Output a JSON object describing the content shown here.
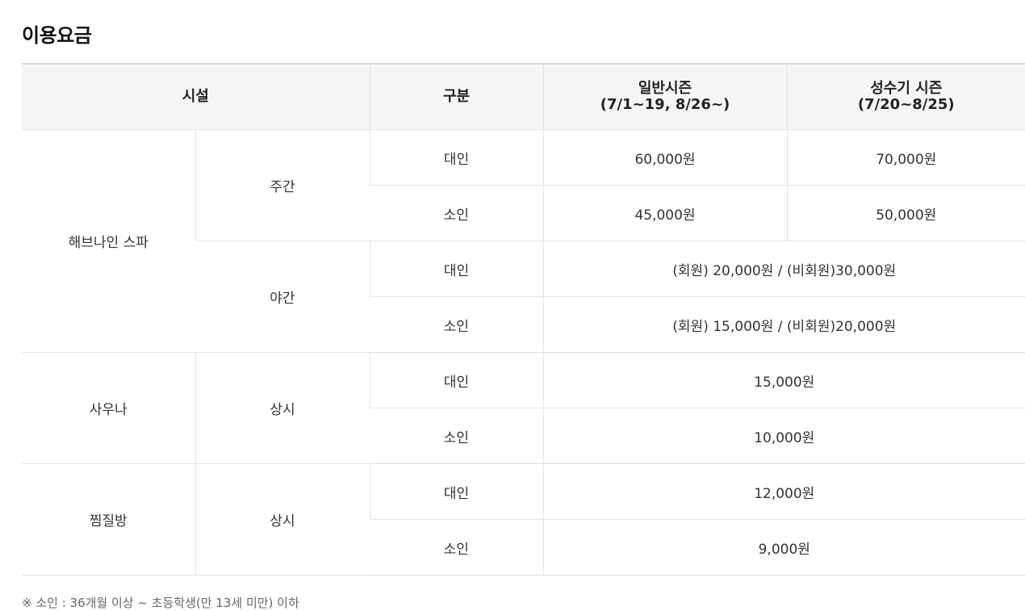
{
  "title": "이용요금",
  "table": {
    "headers": {
      "facility": "시설",
      "category": "구분",
      "regular_season": "일반시즌",
      "regular_season_period": "(7/1~19, 8/26~)",
      "peak_season": "성수기 시즌",
      "peak_season_period": "(7/20~8/25)"
    },
    "spa": {
      "facility": "해브나인 스파",
      "day": {
        "label": "주간",
        "adult": {
          "label": "대인",
          "regular": "60,000원",
          "peak": "70,000원"
        },
        "child": {
          "label": "소인",
          "regular": "45,000원",
          "peak": "50,000원"
        }
      },
      "night": {
        "label": "야간",
        "adult": {
          "label": "대인",
          "price": "(회원) 20,000원 / (비회원)30,000원"
        },
        "child": {
          "label": "소인",
          "price": "(회원) 15,000원 / (비회원)20,000원"
        }
      }
    },
    "sauna": {
      "facility": "사우나",
      "time": "상시",
      "adult": {
        "label": "대인",
        "price": "15,000원"
      },
      "child": {
        "label": "소인",
        "price": "10,000원"
      }
    },
    "jjimjilbang": {
      "facility": "찜질방",
      "time": "상시",
      "adult": {
        "label": "대인",
        "price": "12,000원"
      },
      "child": {
        "label": "소인",
        "price": "9,000원"
      }
    }
  },
  "footnote": "※ 소인 : 36개월 이상 ~ 초등학생(만 13세 미만) 이하"
}
